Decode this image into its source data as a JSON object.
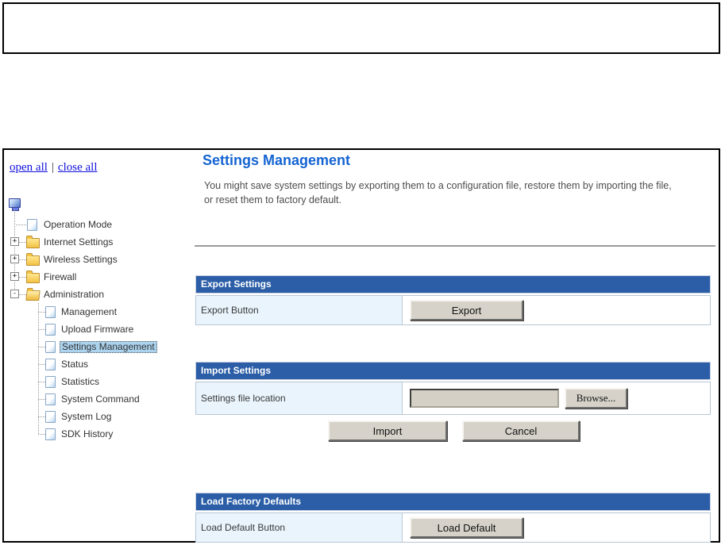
{
  "page": {
    "title": "Settings Management",
    "description": "You might save system settings by exporting them to a configuration file, restore them by importing the file, or reset them to factory default."
  },
  "sidebar": {
    "open_all_label": "open all",
    "close_all_label": "close all",
    "separator": "|",
    "root_icon": "computer-icon",
    "tree": [
      {
        "label": "Operation Mode",
        "icon": "page",
        "level": 0,
        "toggle": null,
        "selected": false
      },
      {
        "label": "Internet Settings",
        "icon": "folder",
        "level": 0,
        "toggle": "+",
        "selected": false
      },
      {
        "label": "Wireless Settings",
        "icon": "folder",
        "level": 0,
        "toggle": "+",
        "selected": false
      },
      {
        "label": "Firewall",
        "icon": "folder",
        "level": 0,
        "toggle": "+",
        "selected": false
      },
      {
        "label": "Administration",
        "icon": "folder-open",
        "level": 0,
        "toggle": "-",
        "selected": false
      },
      {
        "label": "Management",
        "icon": "page",
        "level": 1,
        "toggle": null,
        "selected": false
      },
      {
        "label": "Upload Firmware",
        "icon": "page",
        "level": 1,
        "toggle": null,
        "selected": false
      },
      {
        "label": "Settings Management",
        "icon": "page",
        "level": 1,
        "toggle": null,
        "selected": true
      },
      {
        "label": "Status",
        "icon": "page",
        "level": 1,
        "toggle": null,
        "selected": false
      },
      {
        "label": "Statistics",
        "icon": "page",
        "level": 1,
        "toggle": null,
        "selected": false
      },
      {
        "label": "System Command",
        "icon": "page",
        "level": 1,
        "toggle": null,
        "selected": false
      },
      {
        "label": "System Log",
        "icon": "page",
        "level": 1,
        "toggle": null,
        "selected": false
      },
      {
        "label": "SDK History",
        "icon": "page",
        "level": 1,
        "toggle": null,
        "selected": false
      }
    ]
  },
  "sections": {
    "export": {
      "header": "Export Settings",
      "row_label": "Export Button",
      "button_label": "Export"
    },
    "import": {
      "header": "Import Settings",
      "row_label": "Settings file location",
      "file_input_value": "",
      "browse_button_label": "Browse...",
      "import_button_label": "Import",
      "cancel_button_label": "Cancel"
    },
    "defaults": {
      "header": "Load Factory Defaults",
      "row_label": "Load Default Button",
      "button_label": "Load Default"
    }
  },
  "colors": {
    "section_header_bg": "#2b5ea7",
    "label_cell_bg": "#e9f4fc",
    "page_title": "#1464d2",
    "selected_item_bg": "#abd3ee",
    "link": "#1111dd",
    "button_face": "#d6d2c9",
    "box_border": "#000000"
  }
}
